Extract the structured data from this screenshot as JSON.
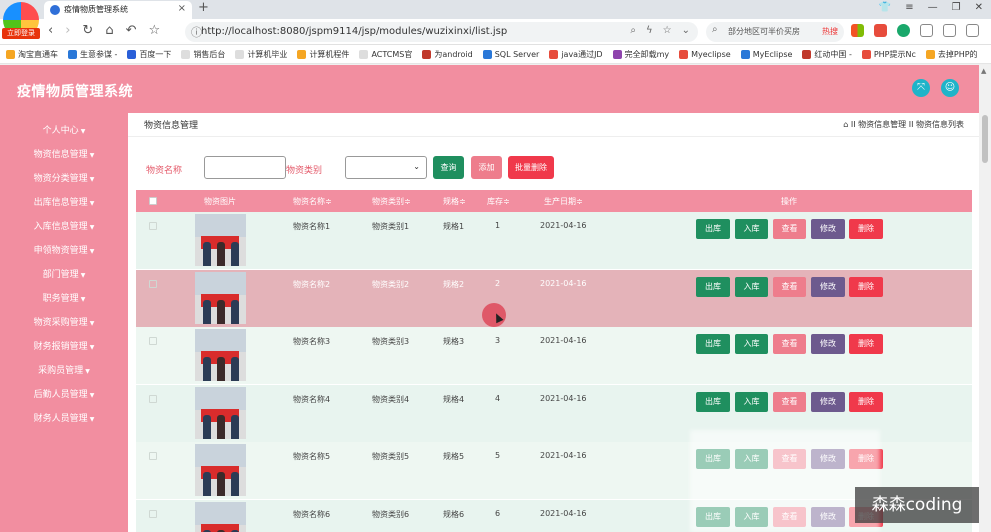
{
  "browser": {
    "logo_badge": "立即登录",
    "tab_title": "疫情物质管理系统",
    "url": "http://localhost:8080/jspm9114/jsp/modules/wuzixinxi/list.jsp",
    "search_text": "部分地区可半价买房",
    "search_hot": "热搜",
    "bookmarks": [
      "淘宝直通车",
      "生意参谋 -",
      "百度一下",
      "销售后台",
      "计算机毕业",
      "计算机程件",
      "ACTCMS官",
      "为android",
      "SQL Server",
      "java通过JD",
      "完全卸载my",
      "Myeclipse",
      "MyEclipse",
      "红动中国 -",
      "PHP提示Nc",
      "去掉PHP的"
    ]
  },
  "header": {
    "system_title": "疫情物质管理系统"
  },
  "sidebar": {
    "items": [
      "个人中心",
      "物资信息管理",
      "物资分类管理",
      "出库信息管理",
      "入库信息管理",
      "申领物资管理",
      "部门管理",
      "职务管理",
      "物资采购管理",
      "财务报销管理",
      "采购员管理",
      "后勤人员管理",
      "财务人员管理"
    ]
  },
  "page": {
    "title": "物资信息管理",
    "breadcrumb": "II 物资信息管理 II 物资信息列表"
  },
  "filter": {
    "name_label": "物资名称",
    "name_value": "",
    "type_label": "物资类别",
    "type_value": "",
    "search_btn": "查询",
    "add_btn": "添加",
    "batch_delete_btn": "批量删除"
  },
  "table": {
    "headers": {
      "image": "物资图片",
      "name": "物资名称≑",
      "type": "物资类别≑",
      "spec": "规格≑",
      "stock": "库存≑",
      "date": "生产日期≑",
      "ops": "操作"
    },
    "actions": {
      "out": "出库",
      "in": "入库",
      "view": "查看",
      "edit": "修改",
      "delete": "删除"
    },
    "rows": [
      {
        "name": "物资名称1",
        "type": "物资类别1",
        "spec": "规格1",
        "stock": "1",
        "date": "2021-04-16"
      },
      {
        "name": "物资名称2",
        "type": "物资类别2",
        "spec": "规格2",
        "stock": "2",
        "date": "2021-04-16"
      },
      {
        "name": "物资名称3",
        "type": "物资类别3",
        "spec": "规格3",
        "stock": "3",
        "date": "2021-04-16"
      },
      {
        "name": "物资名称4",
        "type": "物资类别4",
        "spec": "规格4",
        "stock": "4",
        "date": "2021-04-16"
      },
      {
        "name": "物资名称5",
        "type": "物资类别5",
        "spec": "规格5",
        "stock": "5",
        "date": "2021-04-16"
      },
      {
        "name": "物资名称6",
        "type": "物资类别6",
        "spec": "规格6",
        "stock": "6",
        "date": "2021-04-16"
      }
    ]
  },
  "watermark": "森森coding",
  "colors": {
    "brand_pink": "#f28ea0",
    "btn_green": "#1f8f5f",
    "btn_pink": "#ee7d8c",
    "btn_purple": "#6d5a8e",
    "btn_red": "#f0394b",
    "row_hover": "#e4b3b9",
    "row_even": "#e8f4ef"
  }
}
